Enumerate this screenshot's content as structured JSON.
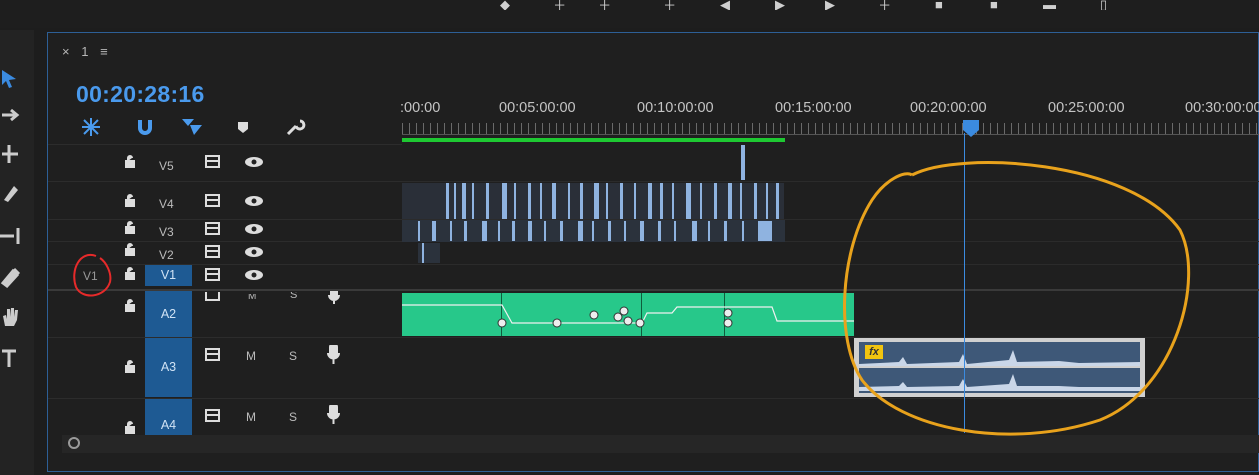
{
  "sequence": {
    "tab_close": "×",
    "tab_name": "1",
    "tab_menu": "≡",
    "timecode": "00:20:28:16"
  },
  "ruler": {
    "labels": [
      ":00:00",
      "00:05:00:00",
      "00:10:00:00",
      "00:15:00:00",
      "00:20:00:00",
      "00:25:00:00",
      "00:30:00:00"
    ]
  },
  "tracks": {
    "video": [
      {
        "label": "V5"
      },
      {
        "label": "V4"
      },
      {
        "label": "V3"
      },
      {
        "label": "V2"
      },
      {
        "label": "V1"
      }
    ],
    "audio": [
      {
        "label": "A2",
        "m": "M",
        "s": "S"
      },
      {
        "label": "A3",
        "m": "M",
        "s": "S"
      },
      {
        "label": "A4",
        "m": "M",
        "s": "S"
      }
    ],
    "source_patch": "V1"
  },
  "clip": {
    "fx_badge": "fx"
  },
  "colors": {
    "accent_blue": "#4a9aed",
    "audio_clip": "#27c88a",
    "annotation_orange": "#e8a21c",
    "annotation_red": "#e62a2a",
    "workarea": "#1ec832"
  },
  "icons": [
    "selection-tool-icon",
    "track-select-icon",
    "ripple-edit-icon",
    "razor-icon",
    "slip-icon",
    "pen-icon",
    "hand-icon",
    "type-icon",
    "snap-icon",
    "linked-selection-icon",
    "add-marker-icon",
    "settings-wrench-icon",
    "lock-icon",
    "toggle-output-icon",
    "eye-icon",
    "microphone-icon"
  ]
}
